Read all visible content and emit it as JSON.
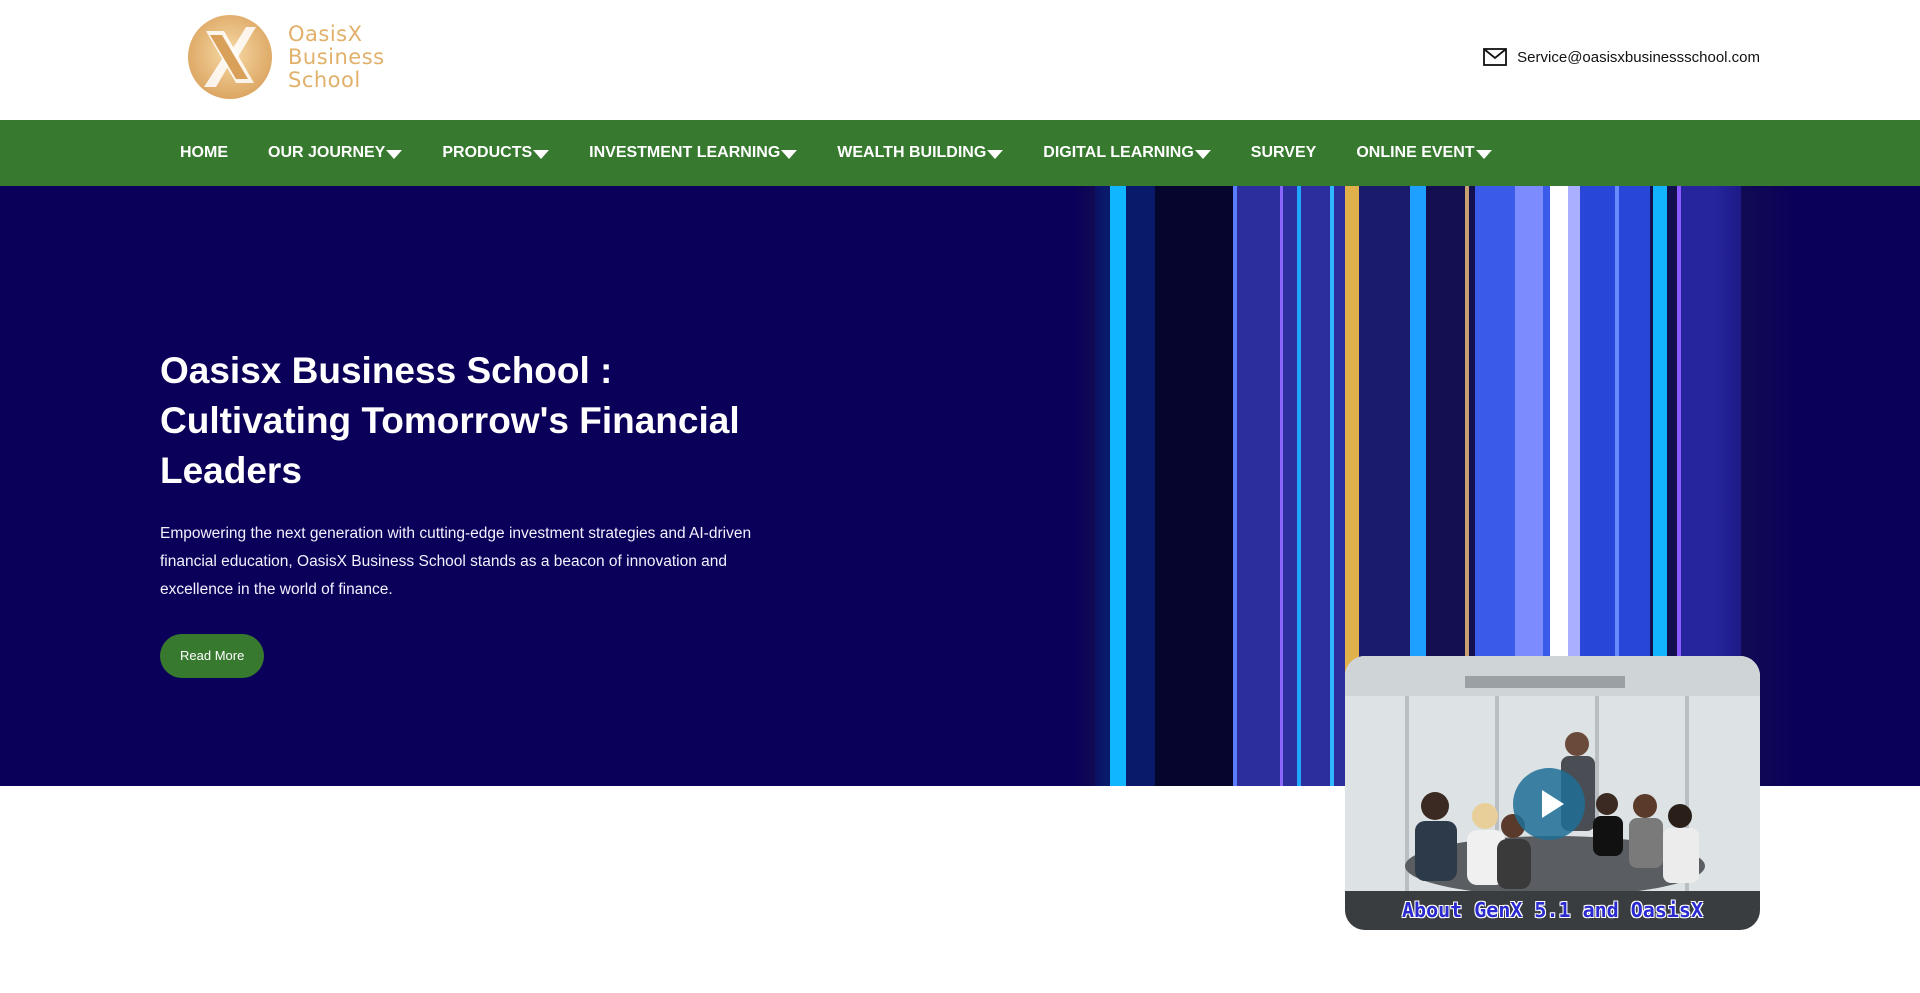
{
  "header": {
    "logo_lines": [
      "OasisX",
      "Business",
      "School"
    ],
    "email": "Service@oasisxbusinessschool.com"
  },
  "nav": {
    "items": [
      {
        "label": "HOME",
        "dropdown": false
      },
      {
        "label": "OUR JOURNEY",
        "dropdown": true
      },
      {
        "label": "PRODUCTS",
        "dropdown": true
      },
      {
        "label": "INVESTMENT LEARNING",
        "dropdown": true
      },
      {
        "label": "WEALTH BUILDING",
        "dropdown": true
      },
      {
        "label": "DIGITAL LEARNING",
        "dropdown": true
      },
      {
        "label": "SURVEY",
        "dropdown": false
      },
      {
        "label": "ONLINE EVENT",
        "dropdown": true
      }
    ]
  },
  "hero": {
    "title": "Oasisx Business School : Cultivating Tomorrow's Financial Leaders",
    "text": "Empowering the next generation with cutting-edge investment strategies and AI-driven financial education, OasisX Business School stands as a beacon of innovation and excellence in the world of finance.",
    "button_label": "Read More"
  },
  "video": {
    "caption": "About GenX 5.1 and OasisX"
  },
  "colors": {
    "brand_green": "#37792f",
    "hero_bg": "#0b0059",
    "logo_gold": "#e1b06a"
  }
}
